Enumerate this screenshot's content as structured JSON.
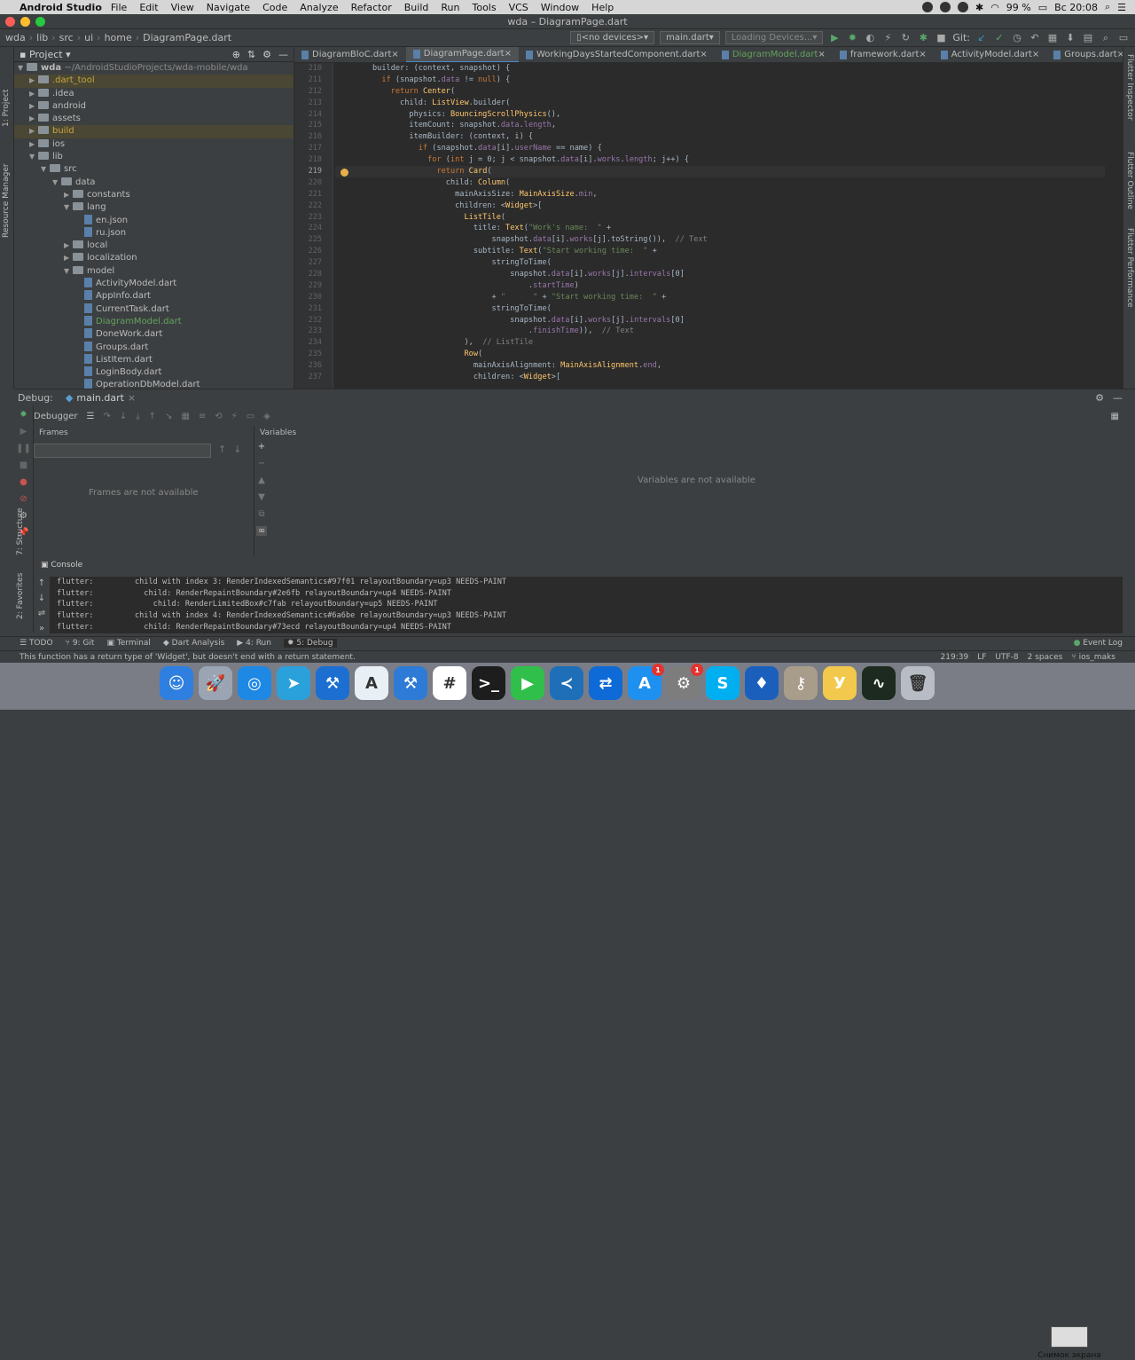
{
  "menubar": {
    "app": "Android Studio",
    "items": [
      "File",
      "Edit",
      "View",
      "Navigate",
      "Code",
      "Analyze",
      "Refactor",
      "Build",
      "Run",
      "Tools",
      "VCS",
      "Window",
      "Help"
    ],
    "battery": "99 %",
    "clock": "Вс 20:08"
  },
  "window_title": "wda – DiagramPage.dart",
  "breadcrumb": [
    "wda",
    "lib",
    "src",
    "ui",
    "home",
    "DiagramPage.dart"
  ],
  "toolbar": {
    "device": "<no devices>",
    "run_config": "main.dart",
    "loading": "Loading Devices...",
    "git_label": "Git:"
  },
  "project_panel": {
    "title": "Project",
    "root": "wda",
    "root_path": "~/AndroidStudioProjects/wda-mobile/wda",
    "tree": [
      {
        "label": ".dart_tool",
        "depth": 1,
        "kind": "folder",
        "arrow": "▶",
        "hl": true
      },
      {
        "label": ".idea",
        "depth": 1,
        "kind": "folder",
        "arrow": "▶",
        "hl": false
      },
      {
        "label": "android",
        "depth": 1,
        "kind": "folder",
        "arrow": "▶",
        "hl": false
      },
      {
        "label": "assets",
        "depth": 1,
        "kind": "folder",
        "arrow": "▶",
        "hl": false
      },
      {
        "label": "build",
        "depth": 1,
        "kind": "folder",
        "arrow": "▶",
        "hl": true
      },
      {
        "label": "ios",
        "depth": 1,
        "kind": "folder",
        "arrow": "▶",
        "hl": false
      },
      {
        "label": "lib",
        "depth": 1,
        "kind": "folder",
        "arrow": "▼",
        "hl": false
      },
      {
        "label": "src",
        "depth": 2,
        "kind": "folder",
        "arrow": "▼",
        "hl": false
      },
      {
        "label": "data",
        "depth": 3,
        "kind": "folder",
        "arrow": "▼",
        "hl": false
      },
      {
        "label": "constants",
        "depth": 4,
        "kind": "folder",
        "arrow": "▶",
        "hl": false
      },
      {
        "label": "lang",
        "depth": 4,
        "kind": "folder",
        "arrow": "▼",
        "hl": false
      },
      {
        "label": "en.json",
        "depth": 5,
        "kind": "file",
        "arrow": "",
        "hl": false
      },
      {
        "label": "ru.json",
        "depth": 5,
        "kind": "file",
        "arrow": "",
        "hl": false
      },
      {
        "label": "local",
        "depth": 4,
        "kind": "folder",
        "arrow": "▶",
        "hl": false
      },
      {
        "label": "localization",
        "depth": 4,
        "kind": "folder",
        "arrow": "▶",
        "hl": false
      },
      {
        "label": "model",
        "depth": 4,
        "kind": "folder",
        "arrow": "▼",
        "hl": false
      },
      {
        "label": "ActivityModel.dart",
        "depth": 5,
        "kind": "file",
        "arrow": "",
        "hl": false
      },
      {
        "label": "AppInfo.dart",
        "depth": 5,
        "kind": "file",
        "arrow": "",
        "hl": false
      },
      {
        "label": "CurrentTask.dart",
        "depth": 5,
        "kind": "file",
        "arrow": "",
        "hl": false
      },
      {
        "label": "DiagramModel.dart",
        "depth": 5,
        "kind": "file",
        "arrow": "",
        "hl": false,
        "color": "#62a35c"
      },
      {
        "label": "DoneWork.dart",
        "depth": 5,
        "kind": "file",
        "arrow": "",
        "hl": false
      },
      {
        "label": "Groups.dart",
        "depth": 5,
        "kind": "file",
        "arrow": "",
        "hl": false
      },
      {
        "label": "ListItem.dart",
        "depth": 5,
        "kind": "file",
        "arrow": "",
        "hl": false
      },
      {
        "label": "LoginBody.dart",
        "depth": 5,
        "kind": "file",
        "arrow": "",
        "hl": false
      },
      {
        "label": "OperationDbModel.dart",
        "depth": 5,
        "kind": "file",
        "arrow": "",
        "hl": false
      }
    ]
  },
  "editor_tabs": [
    {
      "label": "DiagramBloC.dart",
      "active": false
    },
    {
      "label": "DiagramPage.dart",
      "active": true
    },
    {
      "label": "WorkingDaysStartedComponent.dart",
      "active": false
    },
    {
      "label": "DiagramModel.dart",
      "active": false
    },
    {
      "label": "framework.dart",
      "active": false
    },
    {
      "label": "ActivityModel.dart",
      "active": false
    },
    {
      "label": "Groups.dart",
      "active": false
    }
  ],
  "code": {
    "current_line": 219,
    "lines": [
      {
        "n": 210,
        "html": "builder: (context, snapshot) {",
        "indent": 0
      },
      {
        "n": 211,
        "html": "if (snapshot.data != null) {",
        "indent": 1
      },
      {
        "n": 212,
        "html": "return Center(",
        "indent": 2
      },
      {
        "n": 213,
        "html": "child: ListView.builder(",
        "indent": 3
      },
      {
        "n": 214,
        "html": "physics: BouncingScrollPhysics(),",
        "indent": 4
      },
      {
        "n": 215,
        "html": "itemCount: snapshot.data.length,",
        "indent": 4
      },
      {
        "n": 216,
        "html": "itemBuilder: (context, i) {",
        "indent": 4
      },
      {
        "n": 217,
        "html": "if (snapshot.data[i].userName == name) {",
        "indent": 5
      },
      {
        "n": 218,
        "html": "for (int j = 0; j < snapshot.data[i].works.length; j++) {",
        "indent": 6
      },
      {
        "n": 219,
        "html": "return Card(",
        "indent": 7
      },
      {
        "n": 220,
        "html": "child: Column(",
        "indent": 8
      },
      {
        "n": 221,
        "html": "mainAxisSize: MainAxisSize.min,",
        "indent": 9
      },
      {
        "n": 222,
        "html": "children: <Widget>[",
        "indent": 9
      },
      {
        "n": 223,
        "html": "ListTile(",
        "indent": 10
      },
      {
        "n": 224,
        "html": "title: Text(\"Work's name:  \" +",
        "indent": 11
      },
      {
        "n": 225,
        "html": "snapshot.data[i].works[j].toString()),  // Text",
        "indent": 13
      },
      {
        "n": 226,
        "html": "subtitle: Text(\"Start working time:  \" +",
        "indent": 11
      },
      {
        "n": 227,
        "html": "stringToTime(",
        "indent": 13
      },
      {
        "n": 228,
        "html": "snapshot.data[i].works[j].intervals[0]",
        "indent": 15
      },
      {
        "n": 229,
        "html": ".startTime)",
        "indent": 17
      },
      {
        "n": 230,
        "html": "+ \"      \" + \"Start working time:  \" +",
        "indent": 13
      },
      {
        "n": 231,
        "html": "stringToTime(",
        "indent": 13
      },
      {
        "n": 232,
        "html": "snapshot.data[i].works[j].intervals[0]",
        "indent": 15
      },
      {
        "n": 233,
        "html": ".finishTime)),  // Text",
        "indent": 17
      },
      {
        "n": 234,
        "html": "),  // ListTile",
        "indent": 10
      },
      {
        "n": 235,
        "html": "Row(",
        "indent": 10
      },
      {
        "n": 236,
        "html": "mainAxisAlignment: MainAxisAlignment.end,",
        "indent": 11
      },
      {
        "n": 237,
        "html": "children: <Widget>[",
        "indent": 11
      }
    ]
  },
  "debug": {
    "label": "Debug:",
    "tab": "main.dart",
    "debugger": "Debugger",
    "frames_title": "Frames",
    "variables_title": "Variables",
    "frames_empty": "Frames are not available",
    "variables_empty": "Variables are not available",
    "console_title": "Console",
    "console_lines": [
      "flutter:         child with index 3: RenderIndexedSemantics#97f01 relayoutBoundary=up3 NEEDS-PAINT",
      "flutter:           child: RenderRepaintBoundary#2e6fb relayoutBoundary=up4 NEEDS-PAINT",
      "flutter:             child: RenderLimitedBox#c7fab relayoutBoundary=up5 NEEDS-PAINT",
      "flutter:         child with index 4: RenderIndexedSemantics#6a6be relayoutBoundary=up3 NEEDS-PAINT",
      "flutter:           child: RenderRepaintBoundary#73ecd relayoutBoundary=up4 NEEDS-PAINT"
    ]
  },
  "bottom_tabs": [
    "TODO",
    "9: Git",
    "Terminal",
    "Dart Analysis",
    "4: Run",
    "5: Debug"
  ],
  "active_bottom_tab": "5: Debug",
  "event_log": "Event Log",
  "status": {
    "message": "This function has a return type of 'Widget', but doesn't end with a return statement.",
    "position": "219:39",
    "line_sep": "LF",
    "encoding": "UTF-8",
    "indent": "2 spaces",
    "vcs": "ios_maks"
  },
  "side_labels": {
    "left_top": [
      "1: Project",
      "Resource Manager"
    ],
    "left_bottom": [
      "7: Structure",
      "2: Favorites"
    ],
    "right": [
      "Flutter Inspector",
      "Flutter Outline",
      "Flutter Performance"
    ]
  },
  "dock": {
    "screenshot_label": "Снимок экрана",
    "apps": [
      {
        "name": "finder-icon",
        "color": "#2f7fe0",
        "glyph": "☺",
        "badge": ""
      },
      {
        "name": "launchpad-icon",
        "color": "#9aa4b3",
        "glyph": "🚀",
        "badge": ""
      },
      {
        "name": "safari-icon",
        "color": "#1e88e5",
        "glyph": "◎",
        "badge": ""
      },
      {
        "name": "telegram-icon",
        "color": "#2aa1da",
        "glyph": "➤",
        "badge": ""
      },
      {
        "name": "xcode-icon",
        "color": "#1c6fd1",
        "glyph": "⚒",
        "badge": ""
      },
      {
        "name": "android-studio-icon",
        "color": "#e8f0f6",
        "glyph": "A",
        "badge": ""
      },
      {
        "name": "instruments-icon",
        "color": "#2d7bd6",
        "glyph": "⚒",
        "badge": ""
      },
      {
        "name": "slack-icon",
        "color": "#ffffff",
        "glyph": "#",
        "badge": ""
      },
      {
        "name": "terminal-icon",
        "color": "#1d1d1d",
        "glyph": ">_",
        "badge": ""
      },
      {
        "name": "facetime-icon",
        "color": "#2fbf4a",
        "glyph": "▶",
        "badge": ""
      },
      {
        "name": "vscode-icon",
        "color": "#1f6fb8",
        "glyph": "≺",
        "badge": ""
      },
      {
        "name": "teamviewer-icon",
        "color": "#0e6ad6",
        "glyph": "⇄",
        "badge": ""
      },
      {
        "name": "app-store-icon",
        "color": "#1e90f0",
        "glyph": "A",
        "badge": "1"
      },
      {
        "name": "system-preferences-icon",
        "color": "#7d7d7d",
        "glyph": "⚙",
        "badge": "1"
      },
      {
        "name": "skype-icon",
        "color": "#00aff0",
        "glyph": "S",
        "badge": ""
      },
      {
        "name": "sourcetree-icon",
        "color": "#1b5fbd",
        "glyph": "♦",
        "badge": ""
      },
      {
        "name": "keychain-icon",
        "color": "#a89d8a",
        "glyph": "⚷",
        "badge": ""
      },
      {
        "name": "yandex-icon",
        "color": "#f2c94c",
        "glyph": "У",
        "badge": ""
      },
      {
        "name": "activity-monitor-icon",
        "color": "#1d2a1f",
        "glyph": "∿",
        "badge": ""
      },
      {
        "name": "trash-icon",
        "color": "#b8bcc4",
        "glyph": "🗑",
        "badge": ""
      }
    ]
  }
}
